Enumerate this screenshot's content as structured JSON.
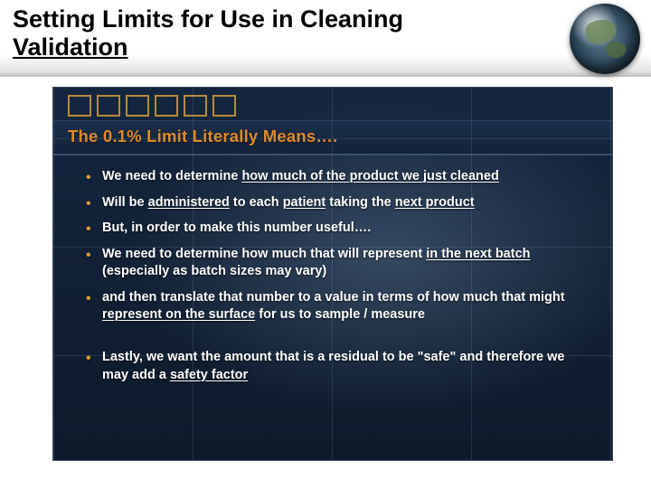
{
  "title_line1": "Setting Limits for Use in Cleaning",
  "title_line2": "Validation",
  "inner": {
    "heading": "The 0.1% Limit Literally Means….",
    "decorative_box_count": 6,
    "bullets_group1": [
      {
        "pre": "We need to determine ",
        "u1": "how much of the product we just cleaned",
        "post": ""
      },
      {
        "pre": "Will be ",
        "u1": "administered",
        "mid1": " to each ",
        "u2": "patient",
        "mid2": " taking the ",
        "u3": "next product",
        "post": ""
      },
      {
        "pre": "But, in order to make this number useful….",
        "u1": "",
        "post": ""
      },
      {
        "pre": "We need to determine how much that will represent ",
        "u1": "in the next batch",
        "post": " (especially as batch sizes may vary)"
      },
      {
        "pre": "and then translate that number to a value in terms of how much that might ",
        "u1": "represent on the surface",
        "post": " for us to sample / measure"
      }
    ],
    "bullets_group2": [
      {
        "pre": "Lastly, we want the amount that is a residual to be \"safe\" and therefore we may add a ",
        "u1": "safety factor",
        "post": ""
      }
    ]
  }
}
